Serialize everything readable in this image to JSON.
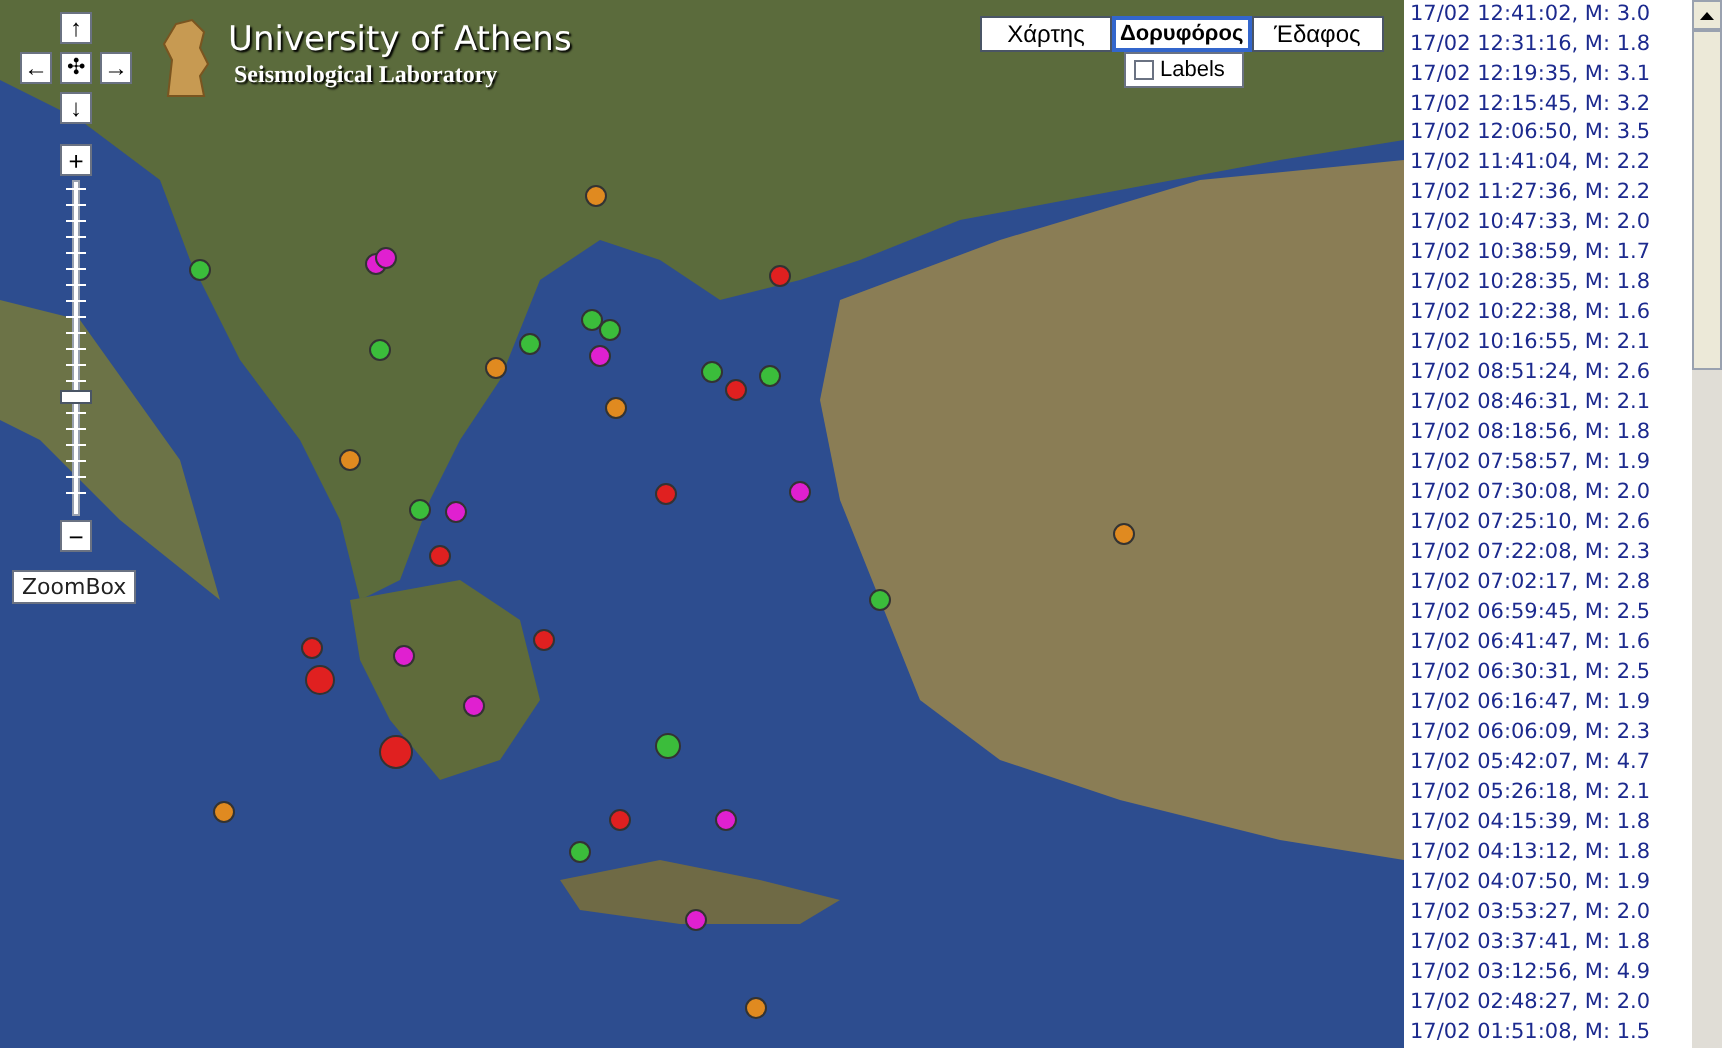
{
  "logo": {
    "title": "University of Athens",
    "subtitle": "Seismological Laboratory"
  },
  "nav": {
    "up": "↑",
    "left": "←",
    "center": "✣",
    "right": "→",
    "down": "↓",
    "zoom_in": "+",
    "zoom_out": "−",
    "zoom": {
      "level": 0.35
    },
    "zoombox": "ZoomBox"
  },
  "map_types": [
    {
      "label": "Χάρτης",
      "selected": false
    },
    {
      "label": "Δορυφόρος",
      "selected": true
    },
    {
      "label": "Έδαφος",
      "selected": false
    }
  ],
  "labels_option": {
    "label": "Labels",
    "checked": false
  },
  "events": [
    "17/02 12:41:02, M: 3.0",
    "17/02 12:31:16, M: 1.8",
    "17/02 12:19:35, M: 3.1",
    "17/02 12:15:45, M: 3.2",
    "17/02 12:06:50, M: 3.5",
    "17/02 11:41:04, M: 2.2",
    "17/02 11:27:36, M: 2.2",
    "17/02 10:47:33, M: 2.0",
    "17/02 10:38:59, M: 1.7",
    "17/02 10:28:35, M: 1.8",
    "17/02 10:22:38, M: 1.6",
    "17/02 10:16:55, M: 2.1",
    "17/02 08:51:24, M: 2.6",
    "17/02 08:46:31, M: 2.1",
    "17/02 08:18:56, M: 1.8",
    "17/02 07:58:57, M: 1.9",
    "17/02 07:30:08, M: 2.0",
    "17/02 07:25:10, M: 2.6",
    "17/02 07:22:08, M: 2.3",
    "17/02 07:02:17, M: 2.8",
    "17/02 06:59:45, M: 2.5",
    "17/02 06:41:47, M: 1.6",
    "17/02 06:30:31, M: 2.5",
    "17/02 06:16:47, M: 1.9",
    "17/02 06:06:09, M: 2.3",
    "17/02 05:42:07, M: 4.7",
    "17/02 05:26:18, M: 2.1",
    "17/02 04:15:39, M: 1.8",
    "17/02 04:13:12, M: 1.8",
    "17/02 04:07:50, M: 1.9",
    "17/02 03:53:27, M: 2.0",
    "17/02 03:37:41, M: 1.8",
    "17/02 03:12:56, M: 4.9",
    "17/02 02:48:27, M: 2.0",
    "17/02 01:51:08, M: 1.5"
  ]
}
